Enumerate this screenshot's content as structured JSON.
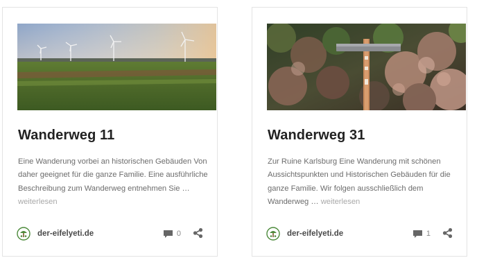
{
  "cards": [
    {
      "title": "Wanderweg 11",
      "excerpt": "Eine Wanderung vorbei an historischen Gebäuden Von daher geeignet für die ganze Familie. Eine ausführliche Beschreibung zum Wanderweg entnehmen Sie … ",
      "read_more": "weiterlesen",
      "author": "der-eifelyeti.de",
      "comment_count": "0",
      "image_subject": "wind turbines over a green field"
    },
    {
      "title": "Wanderweg 31",
      "excerpt": "Zur Ruine Karlsburg Eine Wanderung mit schönen Aussichtspunkten und Historischen Gebäuden für die ganze Familie. Wir folgen ausschließlich dem Wanderweg … ",
      "read_more": "weiterlesen",
      "author": "der-eifelyeti.de",
      "comment_count": "1",
      "image_subject": "wooden trail signpost in front of autumn shrubs"
    }
  ],
  "icons": {
    "comment": "comment-bubble-icon",
    "share": "share-icon",
    "avatar": "site-logo-avatar"
  },
  "colors": {
    "title": "#222222",
    "excerpt": "#6c6c6c",
    "read_more": "#a9a9a9",
    "meta_icon": "#666666",
    "border": "#e3e3e3"
  }
}
